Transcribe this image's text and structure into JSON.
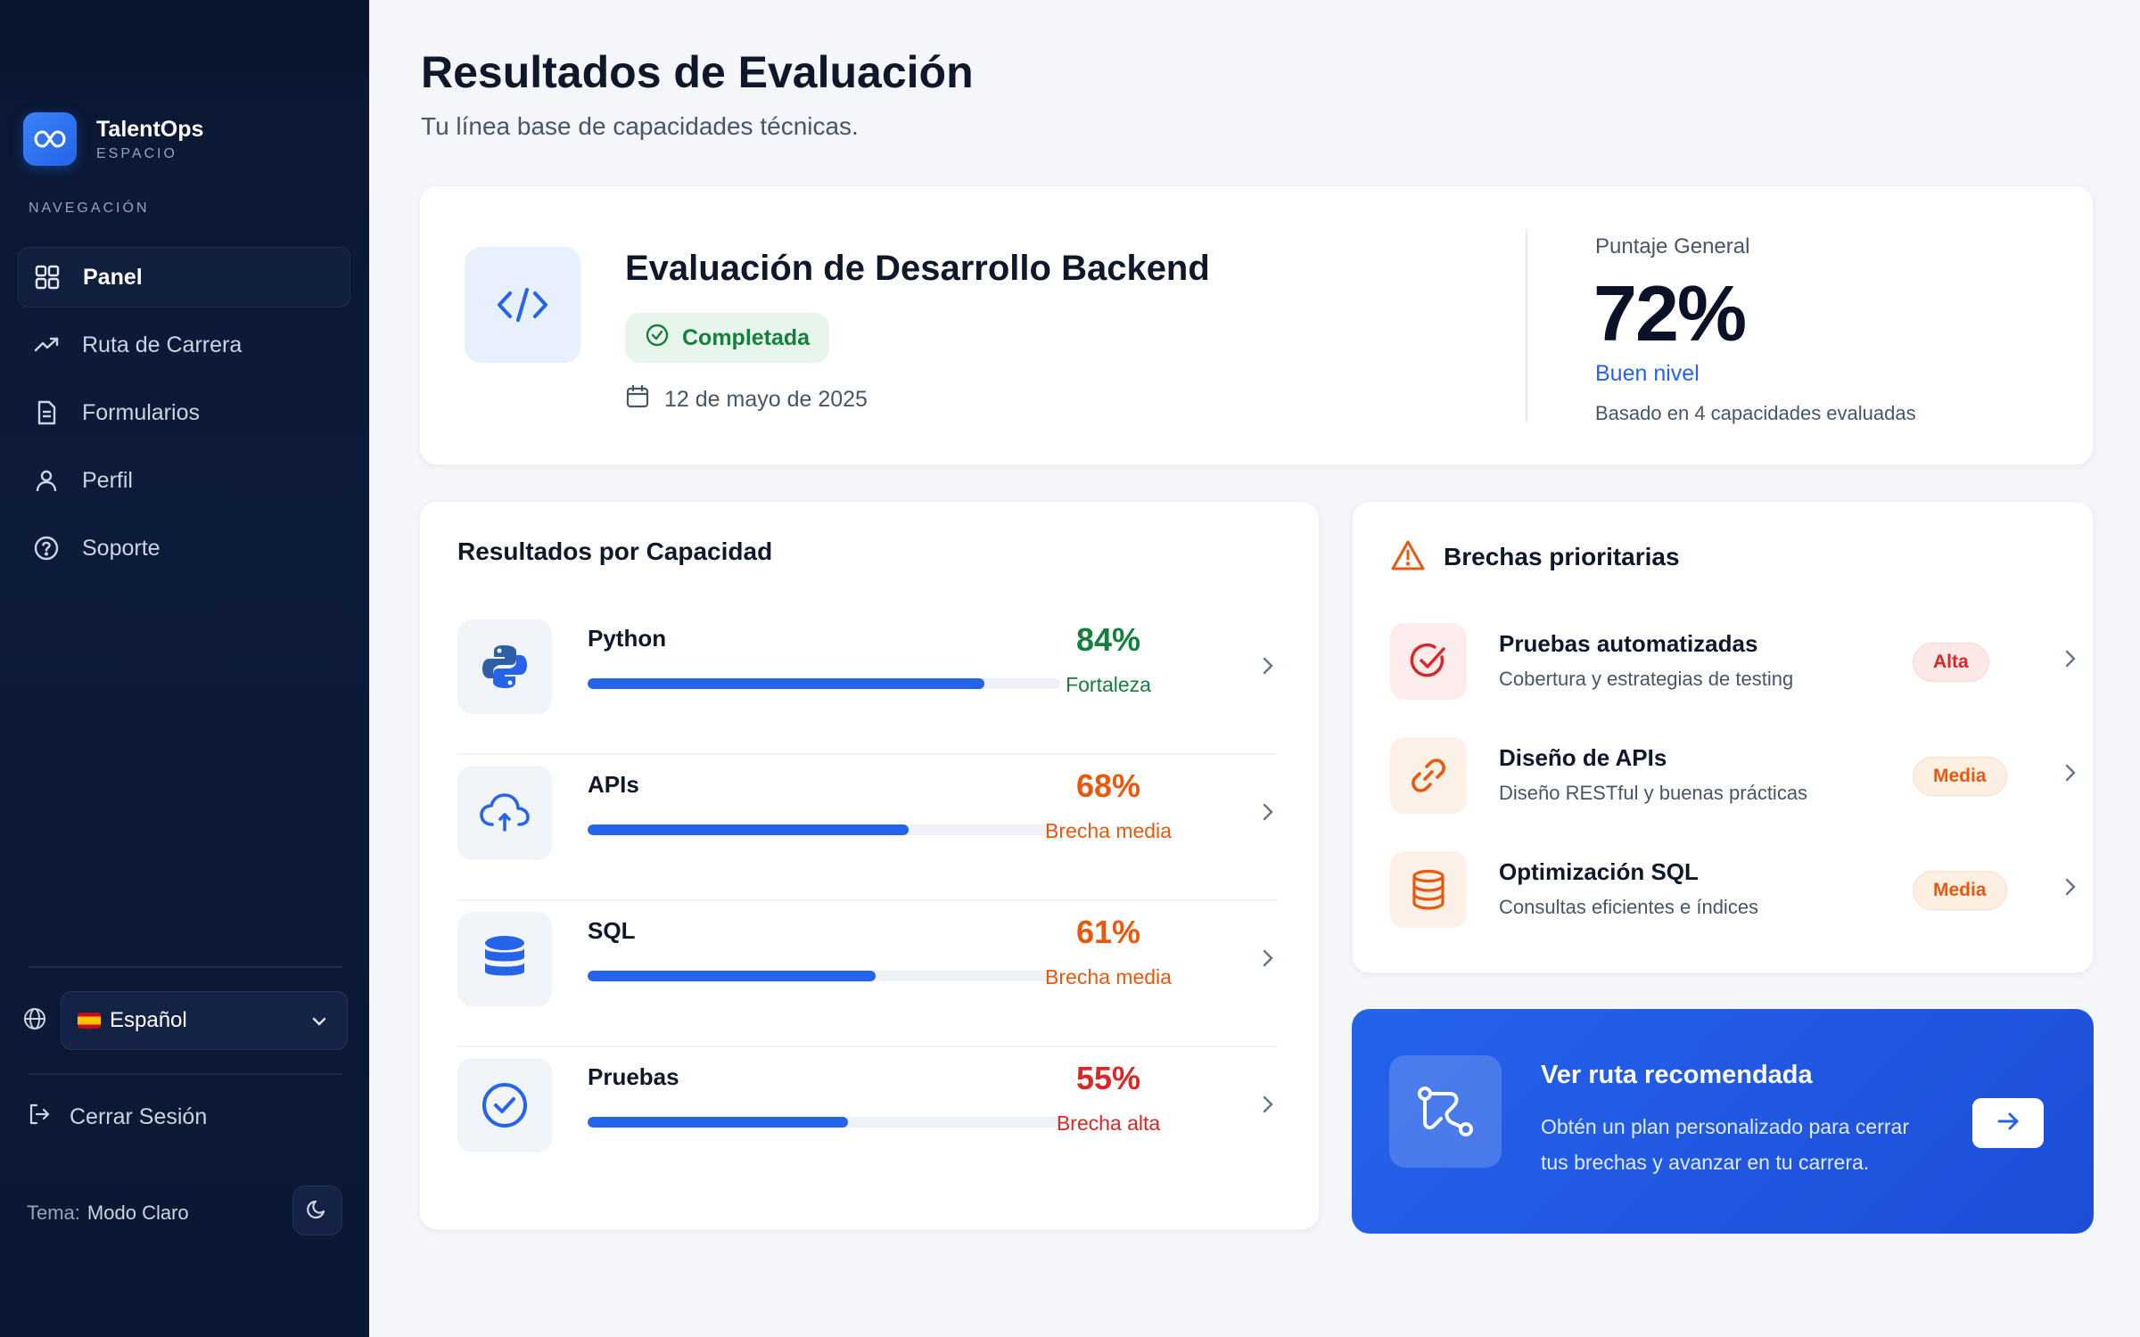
{
  "sidebar": {
    "brand_name": "TalentOps",
    "brand_sub": "ESPACIO",
    "nav_heading": "NAVEGACIÓN",
    "items": [
      {
        "label": "Panel",
        "icon": "grid-icon",
        "active": true
      },
      {
        "label": "Ruta de Carrera",
        "icon": "trending-up-icon"
      },
      {
        "label": "Formularios",
        "icon": "document-icon"
      },
      {
        "label": "Perfil",
        "icon": "user-icon"
      },
      {
        "label": "Soporte",
        "icon": "help-icon"
      }
    ],
    "language": "Español",
    "logout_label": "Cerrar Sesión",
    "theme_label": "Tema:",
    "theme_value": "Modo Claro"
  },
  "header": {
    "title": "Resultados de Evaluación",
    "subtitle": "Tu línea base de capacidades técnicas."
  },
  "assessment": {
    "title": "Evaluación de Desarrollo Backend",
    "status": "Completada",
    "date": "12 de mayo de 2025",
    "score_label": "Puntaje General",
    "score": "72%",
    "level": "Buen nivel",
    "note": "Basado en 4 capacidades evaluadas"
  },
  "capabilities": {
    "title": "Resultados por Capacidad",
    "items": [
      {
        "name": "Python",
        "percent": "84%",
        "progress": 0.84,
        "status": "Fortaleza",
        "tone": "green",
        "icon": "python-icon"
      },
      {
        "name": "APIs",
        "percent": "68%",
        "progress": 0.68,
        "status": "Brecha media",
        "tone": "orange",
        "icon": "cloud-icon"
      },
      {
        "name": "SQL",
        "percent": "61%",
        "progress": 0.61,
        "status": "Brecha media",
        "tone": "orange",
        "icon": "database-icon"
      },
      {
        "name": "Pruebas",
        "percent": "55%",
        "progress": 0.55,
        "status": "Brecha alta",
        "tone": "red",
        "icon": "check-circle-icon"
      }
    ]
  },
  "gaps": {
    "title": "Brechas prioritarias",
    "items": [
      {
        "name": "Pruebas automatizadas",
        "desc": "Cobertura y estrategias de testing",
        "badge": "Alta",
        "level": "alta",
        "icon": "target-check-icon"
      },
      {
        "name": "Diseño de APIs",
        "desc": "Diseño RESTful y buenas prácticas",
        "badge": "Media",
        "level": "media",
        "icon": "link-icon"
      },
      {
        "name": "Optimización SQL",
        "desc": "Consultas eficientes e índices",
        "badge": "Media",
        "level": "media",
        "icon": "database-icon"
      }
    ]
  },
  "cta": {
    "title": "Ver ruta recomendada",
    "desc": "Obtén un plan personalizado para cerrar tus brechas y avanzar en tu carrera."
  },
  "colors": {
    "sidebar_bg": "#0d1b3a",
    "accent": "#2563eb",
    "success": "#15803d",
    "warning": "#ea580c",
    "danger": "#dc2626"
  }
}
